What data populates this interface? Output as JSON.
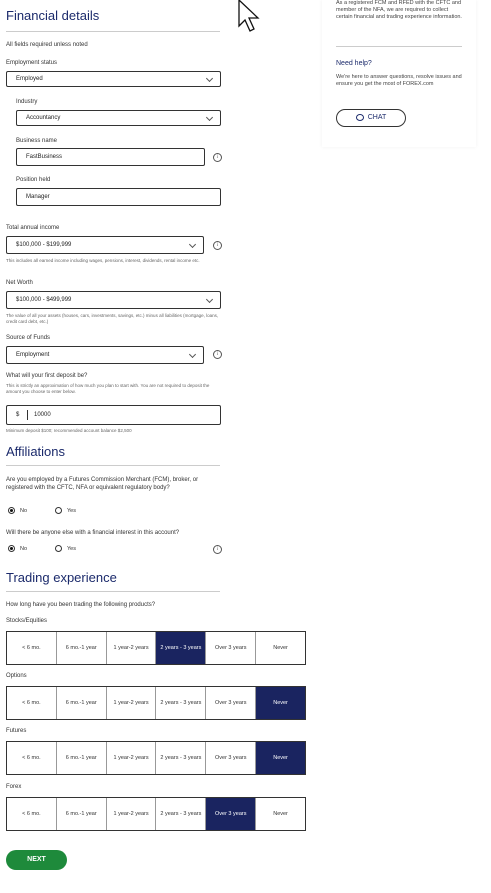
{
  "financial": {
    "title": "Financial details",
    "required_note": "All fields required unless noted",
    "employment_status": {
      "label": "Employment status",
      "value": "Employed"
    },
    "industry": {
      "label": "Industry",
      "value": "Accountancy"
    },
    "business_name": {
      "label": "Business name",
      "value": "FastBusiness"
    },
    "position_held": {
      "label": "Position held",
      "value": "Manager"
    },
    "total_income": {
      "label": "Total annual income",
      "value": "$100,000 - $199,999",
      "note": "This includes all earned income including wages, pensions, interest, dividends, rental income etc."
    },
    "net_worth": {
      "label": "Net Worth",
      "value": "$100,000 - $499,999",
      "note": "The value of all your assets (houses, cars, investments, savings, etc.) minus all liabilities (mortgage, loans, credit card debt, etc.)"
    },
    "source_of_funds": {
      "label": "Source of Funds",
      "value": "Employment"
    },
    "deposit": {
      "label": "What will your first deposit be?",
      "note": "This is strictly an approximation of how much you plan to start with. You are not required to deposit the amount you choose to enter below.",
      "currency": "$",
      "value": "10000",
      "min_note": "Minimum deposit $100; recommended account balance $2,500"
    }
  },
  "affiliations": {
    "title": "Affiliations",
    "q1": "Are you employed by a Futures Commission Merchant (FCM), broker, or registered with the CFTC, NFA or equivalent regulatory body?",
    "q2": "Will there be anyone else with a financial interest in this account?",
    "no": "No",
    "yes": "Yes"
  },
  "trading": {
    "title": "Trading experience",
    "question": "How long have you been trading the following products?",
    "options": [
      "< 6 mo.",
      "6 mo.-1 year",
      "1 year-2 years",
      "2 years - 3 years",
      "Over 3 years",
      "Never"
    ],
    "products": [
      {
        "name": "Stocks/Equities",
        "selected": 3
      },
      {
        "name": "Options",
        "selected": 5
      },
      {
        "name": "Futures",
        "selected": 5
      },
      {
        "name": "Forex",
        "selected": 4
      }
    ]
  },
  "next_label": "NEXT",
  "sidebar": {
    "intro": "As a registered FCM and RFED with the CFTC and member of the NFA, we are required to collect certain financial and trading experience information.",
    "help_title": "Need help?",
    "help_text": "We're here to answer questions, resolve issues and ensure you get the most of FOREX.com",
    "chat_label": "CHAT"
  },
  "info_icon_glyph": "i",
  "colors": {
    "navy": "#1a2460",
    "green": "#1e8a3b"
  }
}
